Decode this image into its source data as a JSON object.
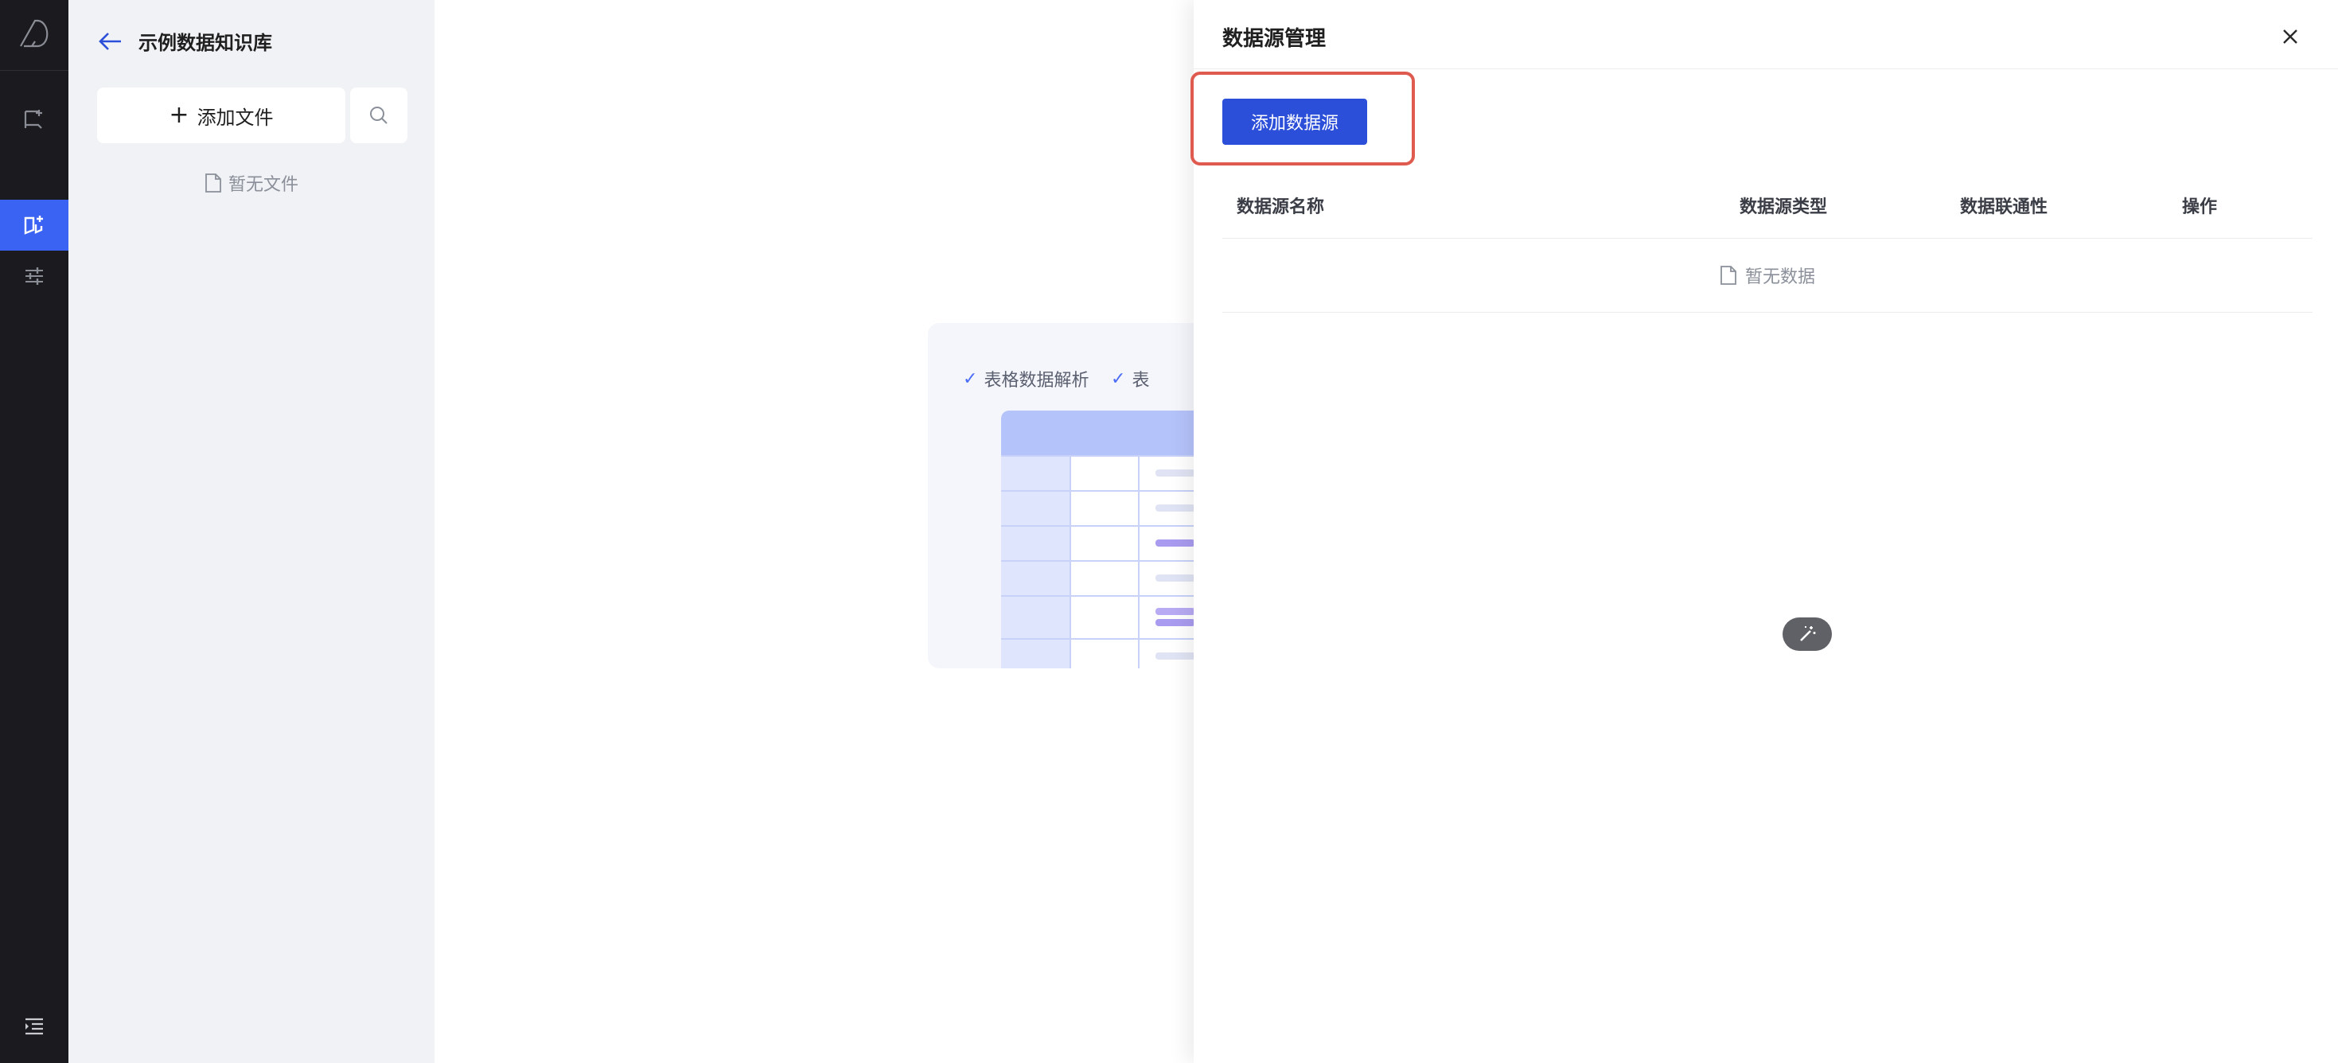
{
  "sidebar": {
    "items": [
      {
        "icon": "logo-icon"
      },
      {
        "icon": "chat-flag-icon"
      },
      {
        "icon": "knowledge-book-icon",
        "active": true
      },
      {
        "icon": "sliders-icon"
      },
      {
        "icon": "collapse-menu-icon"
      }
    ]
  },
  "file_panel": {
    "title": "示例数据知识库",
    "add_file_label": "添加文件",
    "empty_text": "暂无文件"
  },
  "illustration": {
    "features": [
      "表格数据解析",
      "表"
    ]
  },
  "drawer": {
    "title": "数据源管理",
    "add_button_label": "添加数据源",
    "columns": [
      "数据源名称",
      "数据源类型",
      "数据联通性",
      "操作"
    ],
    "empty_text": "暂无数据"
  },
  "colors": {
    "accent": "#2c4fd9",
    "active_rail": "#3b63f3",
    "highlight_border": "#e05b4f"
  }
}
